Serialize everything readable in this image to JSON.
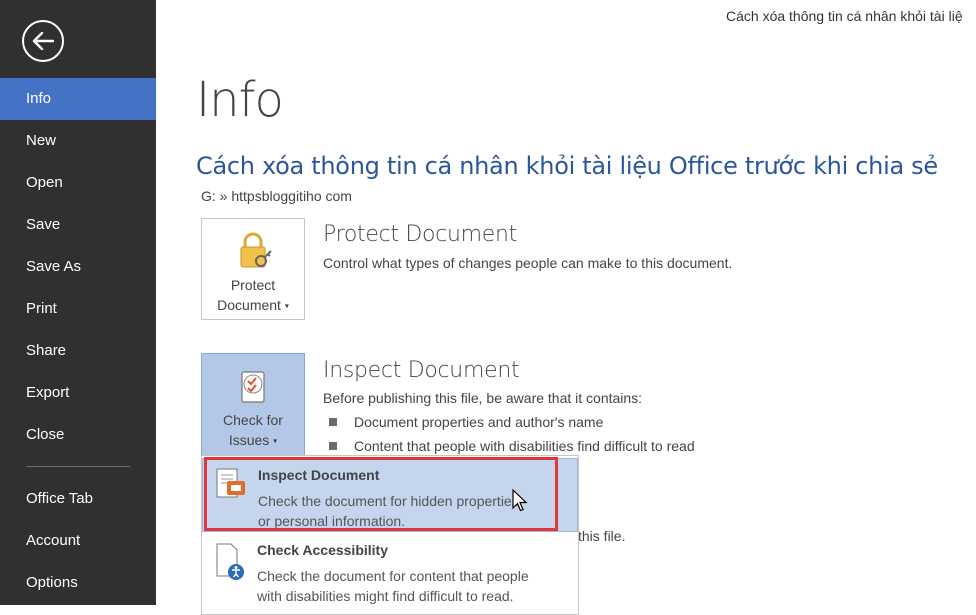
{
  "window": {
    "doc_title": "Cách xóa thông tin cá nhân khỏi tài liệ"
  },
  "sidebar": {
    "back_icon": "arrow-left-icon",
    "items": [
      {
        "label": "Info",
        "active": true
      },
      {
        "label": "New"
      },
      {
        "label": "Open"
      },
      {
        "label": "Save"
      },
      {
        "label": "Save As"
      },
      {
        "label": "Print"
      },
      {
        "label": "Share"
      },
      {
        "label": "Export"
      },
      {
        "label": "Close"
      }
    ],
    "bottom_items": [
      {
        "label": "Office Tab"
      },
      {
        "label": "Account"
      },
      {
        "label": "Options"
      }
    ],
    "bg_color": "#303030",
    "active_color": "#4472c4"
  },
  "main": {
    "page_title": "Info",
    "doc_name": "Cách xóa thông tin cá nhân khỏi tài liệu Office trước khi chia sẻ",
    "doc_path": "G: » httpsbloggitiho com",
    "protect": {
      "button_line1": "Protect",
      "button_line2": "Document",
      "icon": "lock-icon",
      "title": "Protect Document",
      "desc": "Control what types of changes people can make to this document."
    },
    "inspect": {
      "button_line1": "Check for",
      "button_line2": "Issues",
      "icon": "checklist-icon",
      "title": "Inspect Document",
      "desc": "Before publishing this file, be aware that it contains:",
      "bullets": [
        "Document properties and author's name",
        "Content that people with disabilities find difficult to read"
      ],
      "partial": "this file."
    },
    "dropdown": {
      "items": [
        {
          "title": "Inspect Document",
          "desc_line1": "Check the document for hidden properties",
          "desc_line2": "or personal information.",
          "icon": "inspect-document-icon"
        },
        {
          "title": "Check Accessibility",
          "desc_line1": "Check the document for content that people",
          "desc_line2": "with disabilities might find difficult to read.",
          "icon": "accessibility-icon"
        }
      ]
    }
  }
}
